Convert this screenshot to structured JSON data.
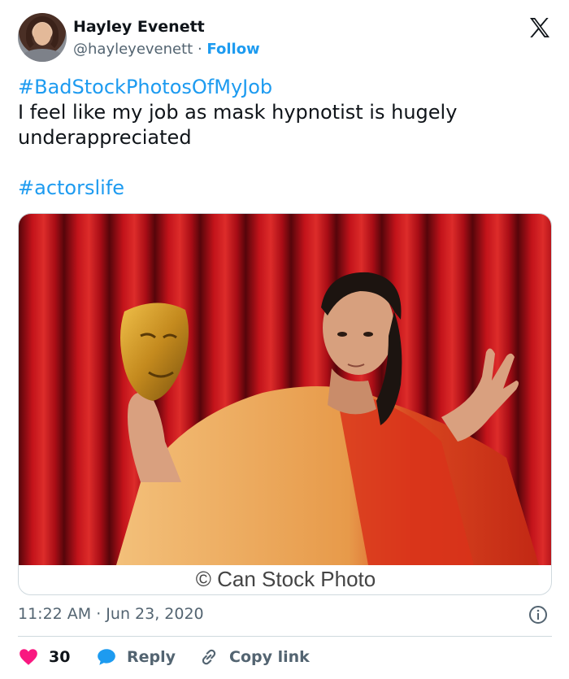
{
  "tweet": {
    "author": {
      "name": "Hayley Evenett",
      "handle": "@hayleyevenett",
      "separator": "·",
      "follow_label": "Follow"
    },
    "text": {
      "hashtag1": "#BadStockPhotosOfMyJob",
      "line1": "I feel like my job as mask hypnotist is hugely",
      "line2": "underappreciated",
      "hashtag2": "#actorslife"
    },
    "media": {
      "watermark": "© Can Stock Photo"
    },
    "timestamp": "11:22 AM · Jun 23, 2020",
    "actions": {
      "likes_count": "30",
      "reply_label": "Reply",
      "copy_label": "Copy link"
    }
  },
  "colors": {
    "accent": "#1d9bf0",
    "like": "#f91880",
    "text": "#0f1419",
    "muted": "#536471",
    "curtain": "#c8101a"
  },
  "icons": [
    "x-logo-icon",
    "info-icon",
    "heart-icon",
    "reply-bubble-icon",
    "link-icon"
  ]
}
